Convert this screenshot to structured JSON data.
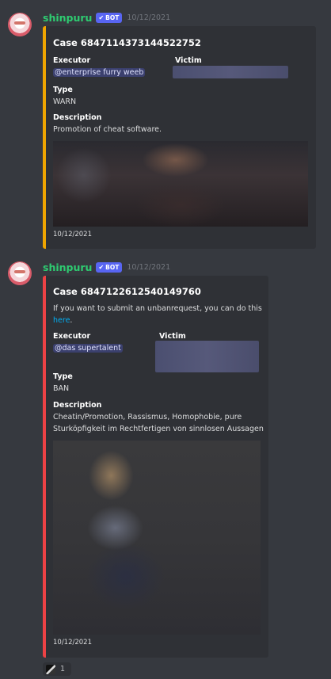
{
  "messages": [
    {
      "username": "shinpuru",
      "bot_tag": "BOT",
      "timestamp": "10/12/2021",
      "embed": {
        "title": "Case 6847114373144522752",
        "executor_label": "Executor",
        "executor_value": "@enterprise furry weeb",
        "victim_label": "Victim",
        "type_label": "Type",
        "type_value": "WARN",
        "description_label": "Description",
        "description_value": "Promotion of cheat software.",
        "footer": "10/12/2021",
        "accent_color": "#f0a500"
      }
    },
    {
      "username": "shinpuru",
      "bot_tag": "BOT",
      "timestamp": "10/12/2021",
      "embed": {
        "title": "Case 6847122612540149760",
        "description_line1": "If you want to submit an unbanrequest, you can do this",
        "description_link": "here",
        "description_end": ".",
        "executor_label": "Executor",
        "executor_value": "@das supertalent",
        "victim_label": "Victim",
        "type_label": "Type",
        "type_value": "BAN",
        "description_label": "Description",
        "description_value_line1": "Cheatin/Promotion, Rassismus, Homophobie, pure",
        "description_value_line2": "Sturköpfigkeit im Rechtfertigen von sinnlosen Aussagen",
        "footer": "10/12/2021",
        "accent_color": "#ed4245"
      },
      "reaction": {
        "count": "1"
      }
    }
  ],
  "colors": {
    "background": "#36393f",
    "embed_bg": "#2f3136",
    "username": "#2ecc71",
    "bot_tag": "#5865f2",
    "link": "#00aff4"
  },
  "icons": {
    "bot_check": "checkmark-icon",
    "reaction_emoji": "custom-emoji-icon"
  }
}
